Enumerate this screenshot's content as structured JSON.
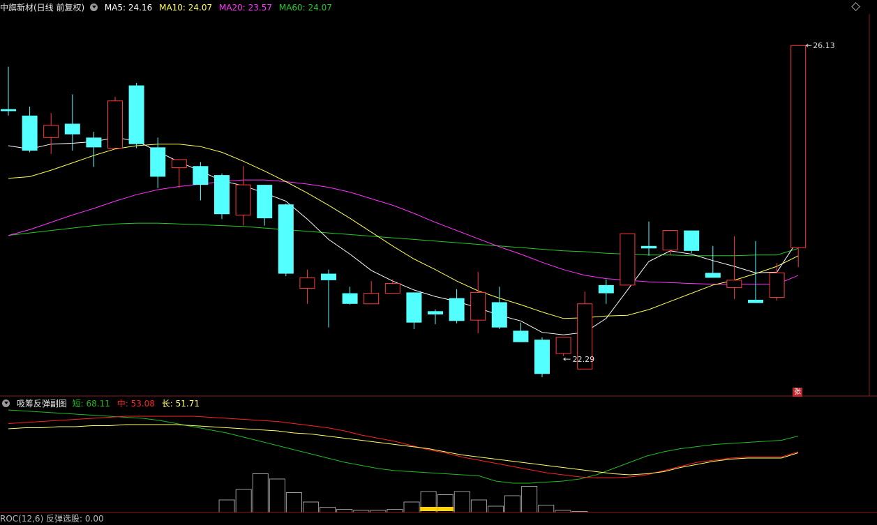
{
  "main_header": {
    "title": "中旗新材(日线 前复权)",
    "ma5": "MA5: 24.16",
    "ma10": "MA10: 24.07",
    "ma20": "MA20: 23.57",
    "ma60": "MA60: 24.07"
  },
  "sub_header": {
    "title": "吸筹反弹副图",
    "short": "短: 68.11",
    "mid": "中: 53.08",
    "long": "长: 51.71"
  },
  "bottom_header": {
    "text": "ROC(12,6) 反弹选股: 0.00"
  },
  "badge": {
    "zhang": "张"
  },
  "colors": {
    "up": "#ff3b3b",
    "down": "#54ffff",
    "ma5": "#ffffff",
    "ma10": "#ffff55",
    "ma20": "#ff33ff",
    "ma60": "#22cc22",
    "short": "#22bb22",
    "mid": "#ff2222",
    "long": "#ffff66",
    "border": "#8b1a1a",
    "bar": "#9a9a9a",
    "accent": "#ffd400"
  },
  "chart_data": [
    {
      "type": "candlestick",
      "ylim": [
        22.0,
        26.5
      ],
      "annotations": {
        "high_label": "26.13",
        "low_label": "22.29"
      },
      "candles": [
        {
          "o": 25.35,
          "h": 25.87,
          "l": 25.27,
          "c": 25.33
        },
        {
          "o": 25.27,
          "h": 25.38,
          "l": 24.82,
          "c": 24.84
        },
        {
          "o": 25.0,
          "h": 25.3,
          "l": 24.8,
          "c": 25.15
        },
        {
          "o": 25.17,
          "h": 25.53,
          "l": 24.84,
          "c": 25.04
        },
        {
          "o": 25.0,
          "h": 25.07,
          "l": 24.64,
          "c": 24.88
        },
        {
          "o": 24.87,
          "h": 25.5,
          "l": 24.87,
          "c": 25.45
        },
        {
          "o": 25.64,
          "h": 25.67,
          "l": 24.87,
          "c": 24.92
        },
        {
          "o": 24.88,
          "h": 25.0,
          "l": 24.38,
          "c": 24.52
        },
        {
          "o": 24.63,
          "h": 24.73,
          "l": 24.38,
          "c": 24.73
        },
        {
          "o": 24.65,
          "h": 24.7,
          "l": 24.23,
          "c": 24.42
        },
        {
          "o": 24.54,
          "h": 24.56,
          "l": 24.0,
          "c": 24.06
        },
        {
          "o": 24.05,
          "h": 24.65,
          "l": 23.92,
          "c": 24.42
        },
        {
          "o": 24.42,
          "h": 24.42,
          "l": 23.92,
          "c": 24.01
        },
        {
          "o": 24.18,
          "h": 24.19,
          "l": 23.3,
          "c": 23.33
        },
        {
          "o": 23.15,
          "h": 23.38,
          "l": 22.96,
          "c": 23.28
        },
        {
          "o": 23.33,
          "h": 23.38,
          "l": 22.67,
          "c": 23.25
        },
        {
          "o": 23.09,
          "h": 23.17,
          "l": 22.95,
          "c": 22.96
        },
        {
          "o": 22.96,
          "h": 23.24,
          "l": 22.96,
          "c": 23.09
        },
        {
          "o": 23.09,
          "h": 23.26,
          "l": 23.09,
          "c": 23.21
        },
        {
          "o": 23.1,
          "h": 23.06,
          "l": 22.65,
          "c": 22.73
        },
        {
          "o": 22.87,
          "h": 22.89,
          "l": 22.71,
          "c": 22.83
        },
        {
          "o": 23.03,
          "h": 23.14,
          "l": 22.72,
          "c": 22.75
        },
        {
          "o": 22.76,
          "h": 23.35,
          "l": 22.6,
          "c": 23.1
        },
        {
          "o": 22.98,
          "h": 23.17,
          "l": 22.65,
          "c": 22.67
        },
        {
          "o": 22.63,
          "h": 22.73,
          "l": 22.54,
          "c": 22.49
        },
        {
          "o": 22.52,
          "h": 22.55,
          "l": 22.06,
          "c": 22.1
        },
        {
          "o": 22.35,
          "h": 22.55,
          "l": 22.32,
          "c": 22.55
        },
        {
          "o": 22.16,
          "h": 23.11,
          "l": 22.16,
          "c": 22.96
        },
        {
          "o": 23.19,
          "h": 23.26,
          "l": 22.96,
          "c": 23.09
        },
        {
          "o": 23.19,
          "h": 23.6,
          "l": 23.19,
          "c": 23.82
        },
        {
          "o": 23.67,
          "h": 23.97,
          "l": 23.55,
          "c": 23.64
        },
        {
          "o": 23.62,
          "h": 23.86,
          "l": 23.56,
          "c": 23.86
        },
        {
          "o": 23.86,
          "h": 23.86,
          "l": 23.58,
          "c": 23.61
        },
        {
          "o": 23.34,
          "h": 23.67,
          "l": 23.32,
          "c": 23.28
        },
        {
          "o": 23.16,
          "h": 23.79,
          "l": 23.02,
          "c": 23.25
        },
        {
          "o": 23.01,
          "h": 23.73,
          "l": 23.0,
          "c": 22.97
        },
        {
          "o": 23.04,
          "h": 23.46,
          "l": 23.0,
          "c": 23.34
        },
        {
          "o": 23.65,
          "h": 26.13,
          "l": 23.41,
          "c": 26.13
        }
      ],
      "ma5": [
        24.9,
        24.86,
        24.92,
        24.93,
        24.95,
        25.0,
        24.96,
        24.83,
        24.7,
        24.59,
        24.47,
        24.41,
        24.32,
        24.22,
        24.0,
        23.75,
        23.57,
        23.37,
        23.24,
        23.13,
        23.05,
        22.99,
        22.91,
        22.82,
        22.75,
        22.61,
        22.58,
        22.61,
        22.78,
        23.13,
        23.48,
        23.61,
        23.57,
        23.49,
        23.42,
        23.34,
        23.35,
        23.75
      ],
      "ma10": [
        24.5,
        24.52,
        24.6,
        24.69,
        24.78,
        24.86,
        24.9,
        24.92,
        24.92,
        24.89,
        24.82,
        24.71,
        24.59,
        24.46,
        24.32,
        24.17,
        24.01,
        23.84,
        23.67,
        23.51,
        23.38,
        23.24,
        23.12,
        23.03,
        22.95,
        22.86,
        22.78,
        22.79,
        22.81,
        22.82,
        22.89,
        22.99,
        23.09,
        23.19,
        23.25,
        23.33,
        23.42,
        23.55
      ],
      "ma20": [
        23.8,
        23.87,
        23.96,
        24.05,
        24.13,
        24.22,
        24.3,
        24.36,
        24.4,
        24.43,
        24.46,
        24.48,
        24.48,
        24.46,
        24.43,
        24.39,
        24.33,
        24.25,
        24.17,
        24.07,
        23.96,
        23.86,
        23.76,
        23.66,
        23.57,
        23.47,
        23.38,
        23.31,
        23.27,
        23.25,
        23.23,
        23.22,
        23.21,
        23.2,
        23.2,
        23.2,
        23.2,
        23.31
      ],
      "ma60": [
        23.8,
        23.83,
        23.86,
        23.89,
        23.92,
        23.94,
        23.95,
        23.95,
        23.94,
        23.93,
        23.92,
        23.91,
        23.89,
        23.87,
        23.85,
        23.83,
        23.81,
        23.79,
        23.77,
        23.75,
        23.73,
        23.71,
        23.69,
        23.67,
        23.65,
        23.63,
        23.61,
        23.6,
        23.58,
        23.57,
        23.56,
        23.56,
        23.55,
        23.55,
        23.55,
        23.56,
        23.56,
        23.64
      ]
    },
    {
      "type": "line",
      "ylim": [
        0,
        100
      ],
      "series": [
        {
          "name": "短",
          "values": [
            98,
            97,
            96,
            95,
            94,
            93,
            92,
            91,
            90,
            88,
            85,
            82,
            79,
            76,
            72,
            68,
            64,
            60,
            56,
            52,
            48,
            45,
            42,
            40,
            39,
            38,
            37,
            36,
            35,
            30,
            28,
            28,
            29,
            30,
            32,
            36,
            42,
            48,
            54,
            58,
            61,
            63,
            65,
            66,
            67,
            68,
            69,
            73
          ]
        },
        {
          "name": "中",
          "values": [
            85,
            86,
            87,
            88,
            89,
            90,
            91,
            92,
            92,
            92,
            92,
            92,
            91,
            90,
            89,
            88,
            87,
            85,
            83,
            81,
            78,
            74,
            71,
            68,
            64,
            60,
            57,
            53,
            50,
            47,
            44,
            41,
            38,
            36,
            34,
            33,
            33,
            34,
            36,
            40,
            44,
            48,
            50,
            52,
            53,
            53,
            53,
            58
          ]
        },
        {
          "name": "长",
          "values": [
            80,
            81,
            81,
            82,
            82,
            83,
            83,
            84,
            84,
            84,
            84,
            83,
            82,
            81,
            80,
            79,
            78,
            76,
            75,
            73,
            71,
            69,
            67,
            65,
            63,
            61,
            58,
            55,
            53,
            51,
            49,
            47,
            45,
            43,
            41,
            39,
            37,
            36,
            37,
            39,
            43,
            46,
            49,
            51,
            52,
            52,
            52,
            57
          ]
        }
      ],
      "bars": [
        0,
        0,
        0,
        0,
        0,
        0,
        0,
        0,
        0,
        0,
        0,
        0,
        0,
        12,
        22,
        37,
        32,
        19,
        10,
        5,
        3,
        2,
        2,
        3,
        10,
        20,
        17,
        20,
        12,
        6,
        16,
        25,
        7,
        2,
        1,
        0,
        0,
        0,
        0,
        0,
        0,
        0,
        0,
        0,
        0,
        0,
        0,
        0
      ],
      "yellow_bar_value": 4
    }
  ]
}
